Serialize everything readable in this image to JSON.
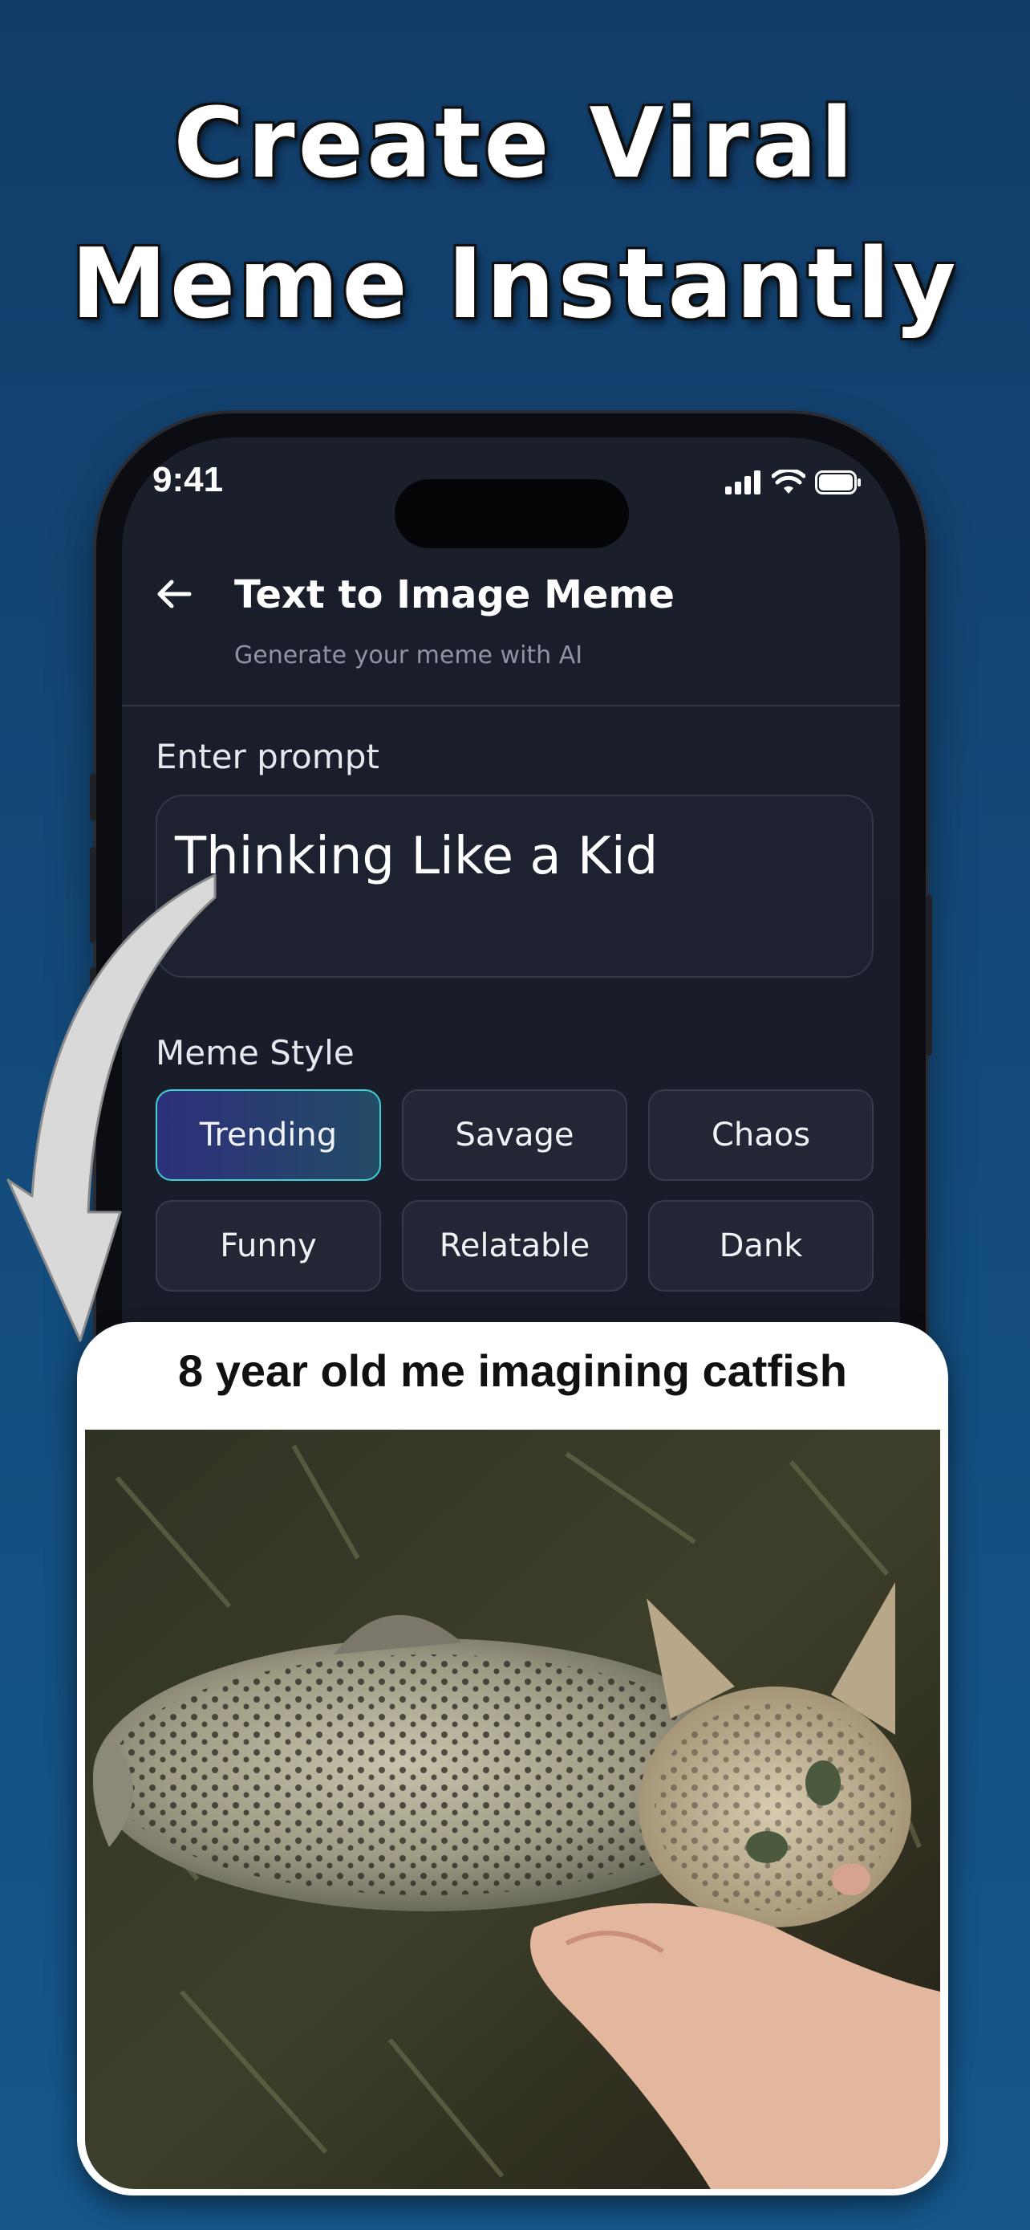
{
  "headline": {
    "line1": "Create Viral",
    "line2": "Meme Instantly"
  },
  "status_bar": {
    "time": "9:41",
    "icons": [
      "signal-icon",
      "wifi-icon",
      "battery-icon"
    ]
  },
  "header": {
    "back_icon": "arrow-left-icon",
    "title": "Text to Image Meme",
    "subtitle": "Generate your meme with AI"
  },
  "prompt": {
    "label": "Enter prompt",
    "value": "Thinking Like a Kid"
  },
  "meme_style": {
    "label": "Meme Style",
    "options": [
      "Trending",
      "Savage",
      "Chaos",
      "Funny",
      "Relatable",
      "Dank"
    ],
    "selected": "Trending"
  },
  "meme": {
    "caption": "8 year old me imagining catfish",
    "image": "catfish-image"
  },
  "colors": {
    "background": "#134a7a",
    "screen": "#1b1e2b",
    "chip_active_border": "#3fd0d4",
    "chip_active_bg": "#2d2f7a"
  }
}
